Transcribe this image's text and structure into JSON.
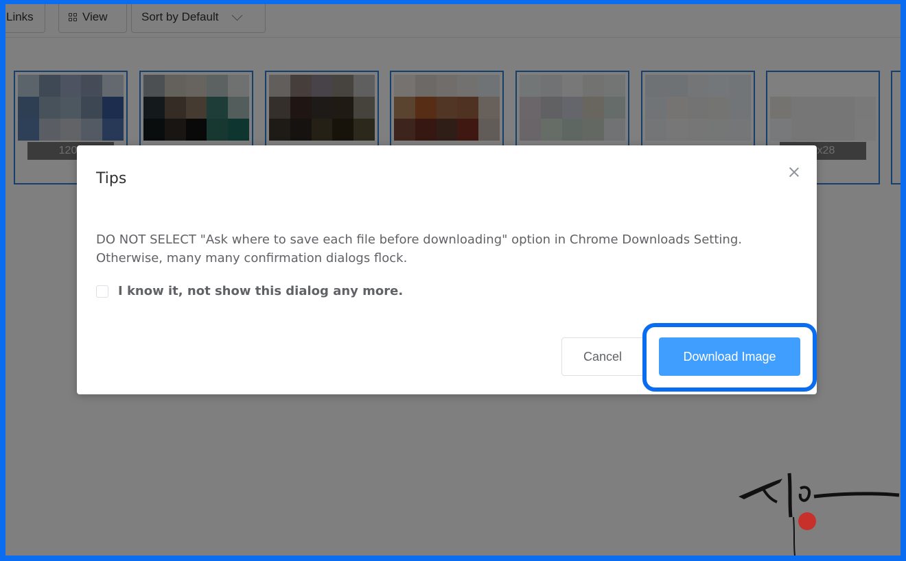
{
  "toolbar": {
    "links_label": "Links",
    "view_label": "View",
    "sort_label": "Sort by Default"
  },
  "thumbnails": [
    {
      "label": "120x",
      "colors": [
        "#b9c8d6",
        "#7e93ad",
        "#9aa6c2",
        "#8a98b0",
        "#c9d3de",
        "#5c7ea8",
        "#8ea4b6",
        "#9aaec0",
        "#7a8ea6",
        "#3a5a9a",
        "#5d7eb0",
        "#b5bdc8",
        "#c2c6cc",
        "#a7b4c6",
        "#5072b0"
      ]
    },
    {
      "label": "",
      "colors": [
        "#9aa1a6",
        "#c9c1b8",
        "#cfc8c0",
        "#b7c4c2",
        "#dfe2e2",
        "#293437",
        "#6b5a4a",
        "#8a7760",
        "#3f7b70",
        "#a6bdb9",
        "#151a1c",
        "#302a24",
        "#131313",
        "#2f6e62",
        "#1c6b60"
      ]
    },
    {
      "label": "",
      "colors": [
        "#c4bdb6",
        "#8a7d77",
        "#8f8790",
        "#8e8980",
        "#c1bfbe",
        "#6a5e56",
        "#3e2a24",
        "#3a342f",
        "#3f3528",
        "#8b8677",
        "#3d352c",
        "#2a2520",
        "#4b412c",
        "#2e2617",
        "#595039"
      ]
    },
    {
      "label": "",
      "colors": [
        "#ebe5df",
        "#d9d3cc",
        "#e0dad4",
        "#e6e3de",
        "#dfe6ec",
        "#b7885f",
        "#b15b2c",
        "#a36c4c",
        "#a06544",
        "#d1c3b7",
        "#7a4a3a",
        "#6e2e22",
        "#5e3a2e",
        "#7e3022",
        "#c4b8b0"
      ]
    },
    {
      "label": "",
      "colors": [
        "#e6ecee",
        "#e2e5e6",
        "#eff0ef",
        "#e5e6e2",
        "#e7eae9",
        "#d7cdd2",
        "#c2c0c7",
        "#c9ccd6",
        "#d1ccbd",
        "#cdd9d4",
        "#d2cad3",
        "#ccd9cc",
        "#bfcfc6",
        "#c7d1c5",
        "#e0e4e6"
      ]
    },
    {
      "label": "",
      "colors": [
        "#dfe4ea",
        "#dde4eb",
        "#e6ebee",
        "#e9eef2",
        "#e3ebf0",
        "#e3e8ec",
        "#ebe8e5",
        "#e6e6e6",
        "#e9e9e6",
        "#e5eaef",
        "#e7ebef",
        "#eeeeee",
        "#eceded",
        "#ebeced",
        "#e8edf1"
      ]
    },
    {
      "label": "0x28",
      "colors": [
        "#ffffff",
        "#ffffff",
        "#ffffff",
        "#ffffff",
        "#ffffff",
        "#e8e6e0",
        "#ececec",
        "#ececec",
        "#ececec",
        "#f2f2f2",
        "#eef2f5",
        "#ececec",
        "#ececec",
        "#ececec",
        "#f4f4f4"
      ]
    }
  ],
  "dialog": {
    "title": "Tips",
    "message": "DO NOT SELECT \"Ask where to save each file before downloading\" option in Chrome Downloads Setting. Otherwise, many many confirmation dialogs flock.",
    "checkbox_label": "I know it, not show this dialog any more.",
    "checkbox_checked": false,
    "cancel_label": "Cancel",
    "primary_label": "Download Image",
    "primary_color": "#409eff"
  },
  "colors": {
    "frame": "#0a6cf0",
    "thumb_border": "#2f7ed8",
    "overlay": "rgba(0,0,0,0.5)"
  }
}
